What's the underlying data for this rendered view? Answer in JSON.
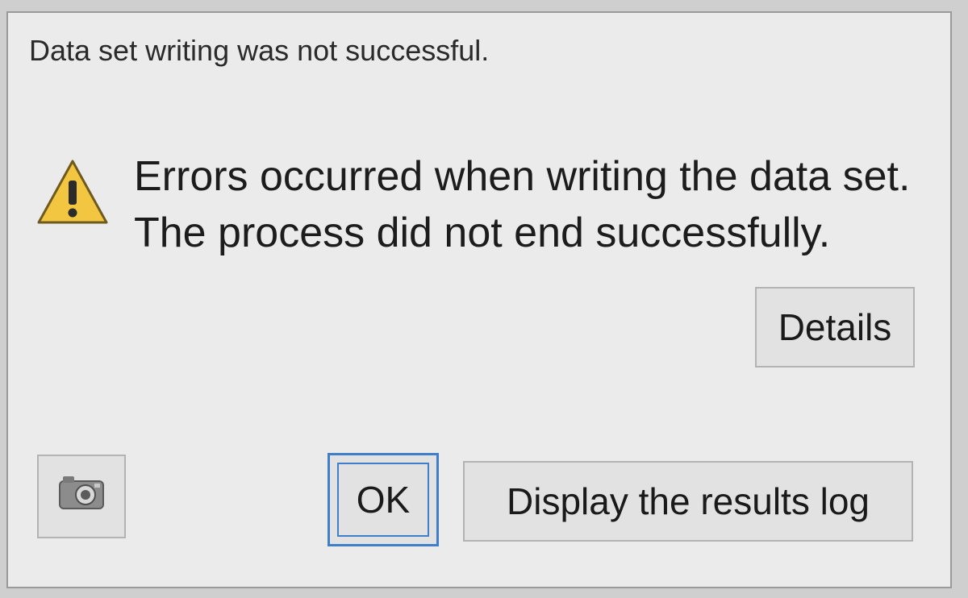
{
  "dialog": {
    "title": "Data set writing was not successful.",
    "icon": "warning-icon",
    "message_lines": [
      "Errors occurred when writing the data set.",
      "The process did not end successfully."
    ]
  },
  "buttons": {
    "details_label": "Details",
    "snapshot_icon": "camera-icon",
    "ok_label": "OK",
    "log_label": "Display the results log"
  },
  "colors": {
    "dialog_background": "#ebebeb",
    "warning_fill": "#f2c641",
    "default_button_border": "#3f7fc9"
  }
}
